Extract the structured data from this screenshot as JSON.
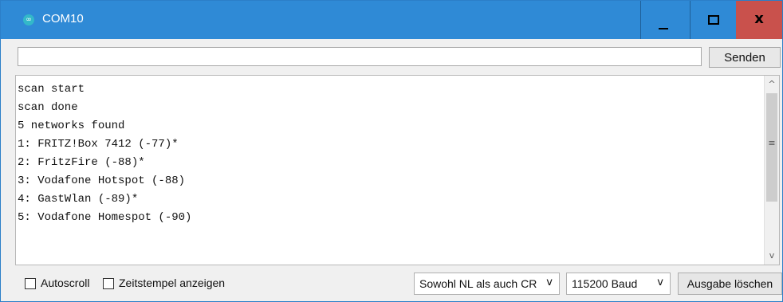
{
  "window": {
    "title": "COM10",
    "icon": "arduino-infinity-icon",
    "app_icon_glyph": "∞",
    "min_glyph": "",
    "close_glyph": "x"
  },
  "send": {
    "input_value": "",
    "button_label": "Senden"
  },
  "output": {
    "lines": [
      "scan start",
      "scan done",
      "5 networks found",
      "1: FRITZ!Box 7412 (-77)*",
      "2: FritzFire (-88)*",
      "3: Vodafone Hotspot (-88)",
      "4: GastWlan (-89)*",
      "5: Vodafone Homespot (-90)"
    ]
  },
  "scrollbar": {
    "up_glyph": "^",
    "down_glyph": "v",
    "grip_glyph": "≡"
  },
  "footer": {
    "autoscroll_label": "Autoscroll",
    "autoscroll_checked": false,
    "timestamp_label": "Zeitstempel anzeigen",
    "timestamp_checked": false,
    "line_ending_value": "Sowohl NL als auch CR",
    "baud_value": "115200 Baud",
    "chevron_glyph": "v",
    "clear_button_label": "Ausgabe löschen"
  },
  "colors": {
    "titlebar": "#2f8ad6",
    "close_button": "#c9514c",
    "background": "#f0f0f0"
  }
}
